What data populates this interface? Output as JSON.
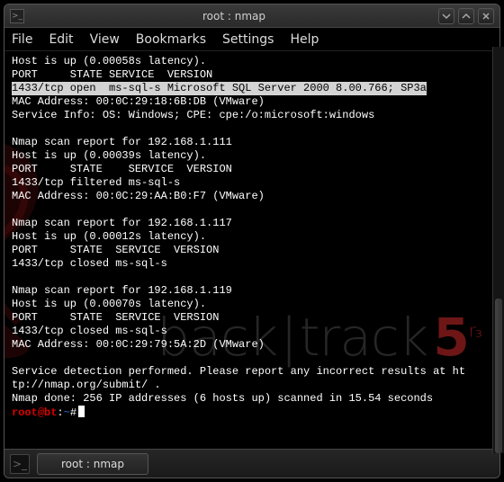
{
  "title": "root : nmap",
  "menu": {
    "file": "File",
    "edit": "Edit",
    "view": "View",
    "bookmarks": "Bookmarks",
    "settings": "Settings",
    "help": "Help"
  },
  "terminal": {
    "lines": [
      "Host is up (0.00058s latency).",
      "PORT     STATE SERVICE  VERSION"
    ],
    "highlight": "1433/tcp open  ms-sql-s Microsoft SQL Server 2000 8.00.766; SP3a",
    "lines2": [
      "MAC Address: 00:0C:29:18:6B:DB (VMware)",
      "Service Info: OS: Windows; CPE: cpe:/o:microsoft:windows",
      "",
      "Nmap scan report for 192.168.1.111",
      "Host is up (0.00039s latency).",
      "PORT     STATE    SERVICE  VERSION",
      "1433/tcp filtered ms-sql-s",
      "MAC Address: 00:0C:29:AA:B0:F7 (VMware)",
      "",
      "Nmap scan report for 192.168.1.117",
      "Host is up (0.00012s latency).",
      "PORT     STATE  SERVICE  VERSION",
      "1433/tcp closed ms-sql-s",
      "",
      "Nmap scan report for 192.168.1.119",
      "Host is up (0.00070s latency).",
      "PORT     STATE  SERVICE  VERSION",
      "1433/tcp closed ms-sql-s",
      "MAC Address: 00:0C:29:79:5A:2D (VMware)",
      "",
      "Service detection performed. Please report any incorrect results at ht",
      "tp://nmap.org/submit/ .",
      "Nmap done: 256 IP addresses (6 hosts up) scanned in 15.54 seconds"
    ],
    "prompt": {
      "user": "root",
      "host": "bt",
      "path": "~",
      "sym": "#"
    }
  },
  "watermark": {
    "left": "back",
    "right": "track",
    "ver": "5",
    "rel": "r₃"
  },
  "taskbar": {
    "item": "root : nmap"
  }
}
